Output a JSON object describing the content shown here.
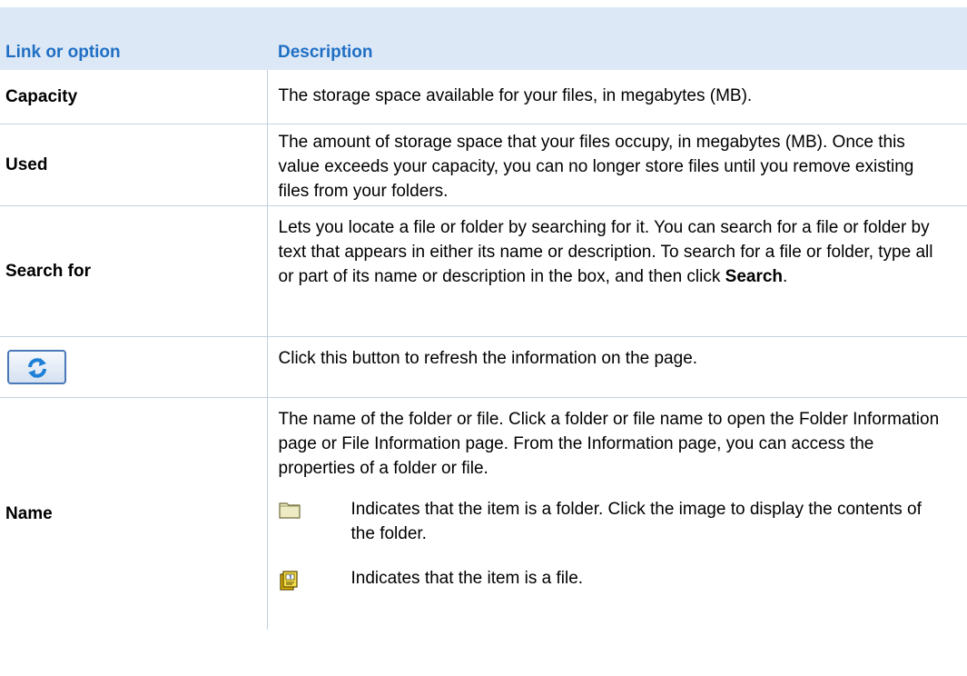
{
  "header": {
    "col_option": "Link or option",
    "col_description": "Description"
  },
  "rows": {
    "capacity": {
      "label": "Capacity",
      "description": "The storage space available for your files, in megabytes (MB)."
    },
    "used": {
      "label": "Used",
      "description": "The amount of storage space that your files occupy, in megabytes (MB). Once this value exceeds your capacity, you can no longer store files until you remove existing files from your folders."
    },
    "search": {
      "label": "Search for",
      "description_before": "Lets you locate a file or folder by searching for it. You can search for a file or folder by text that appears in either its name or description. To search for a file or folder, type all or part of its name or description in the box, and then click ",
      "description_bold": "Search",
      "description_after": "."
    },
    "refresh": {
      "icon": "refresh-icon",
      "description": "Click this button to refresh the information on the page."
    },
    "name": {
      "label": "Name",
      "description": "The name of the folder or file. Click a folder or file name to open the Folder Information page or File Information page. From the Information page, you can access the properties of a folder or file.",
      "folder_icon": "folder-icon",
      "folder_text": "Indicates that the item is a folder. Click the image to display the contents of the folder.",
      "file_icon": "file-icon",
      "file_text": "Indicates that the item is a file."
    }
  },
  "colors": {
    "header_bg": "#dde8f6",
    "header_text": "#1f6fc4",
    "rule": "#c5d1e0"
  }
}
